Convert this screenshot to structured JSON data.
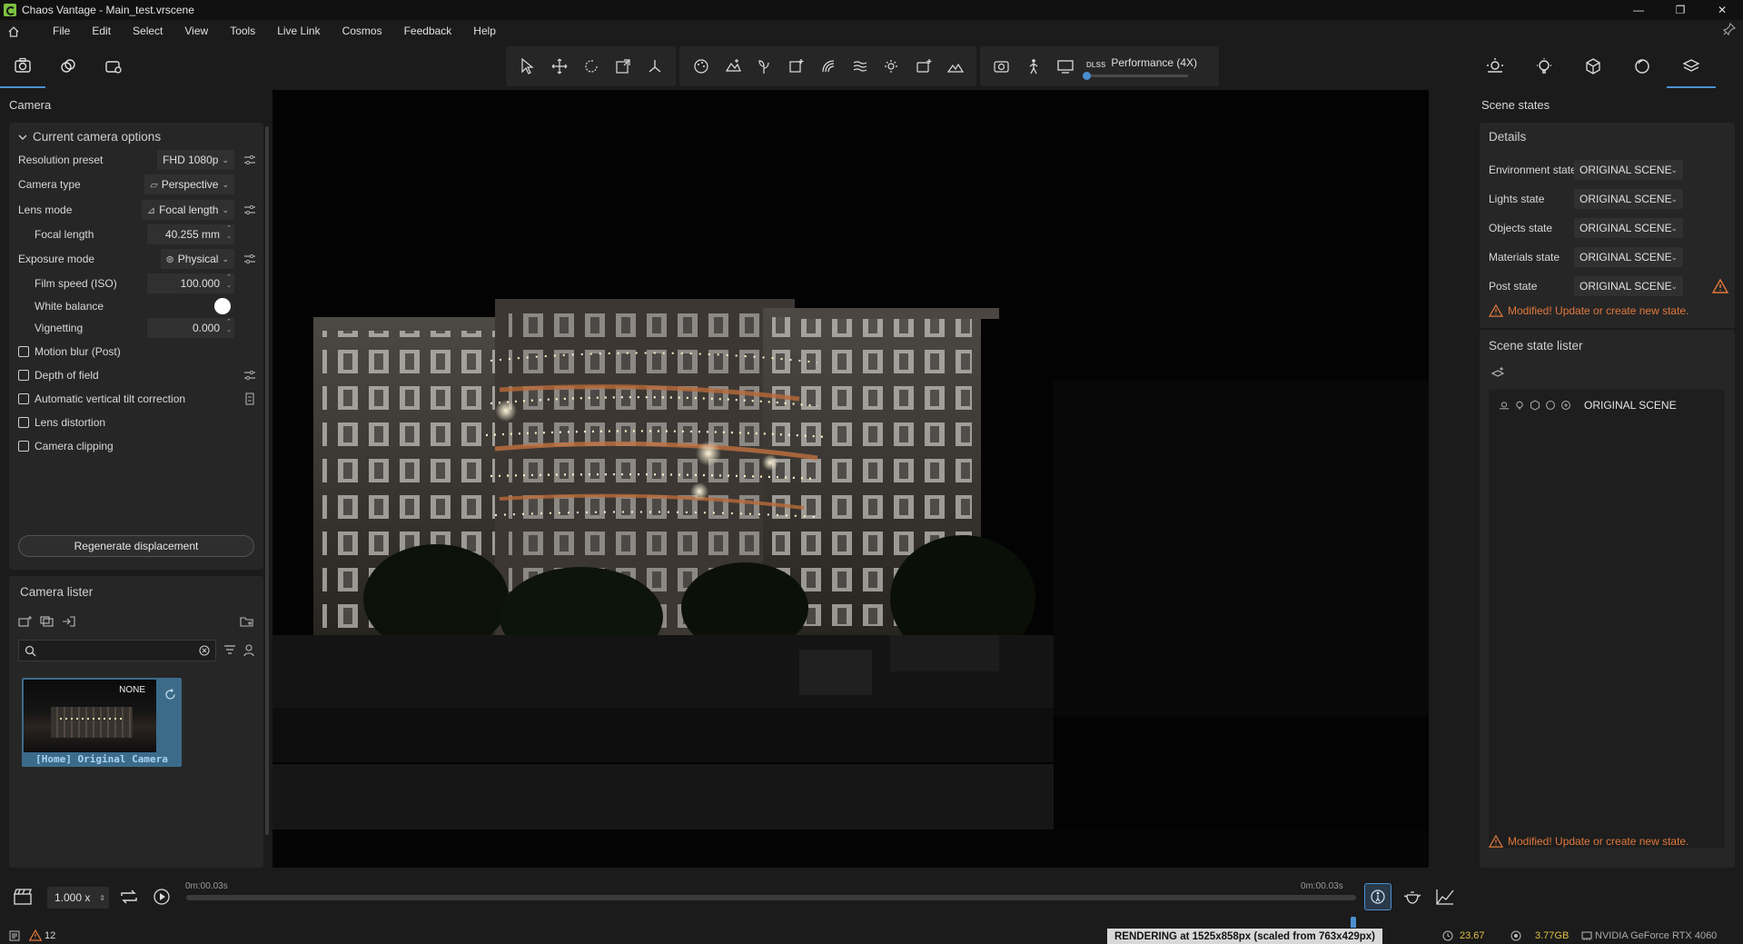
{
  "window": {
    "title": "Chaos Vantage - Main_test.vrscene"
  },
  "menu": [
    "File",
    "Edit",
    "Select",
    "View",
    "Tools",
    "Live Link",
    "Cosmos",
    "Feedback",
    "Help"
  ],
  "toolbar": {
    "performance_label": "Performance (4X)",
    "performance_level": 0.0,
    "dlss_label": "DLSS"
  },
  "left": {
    "panel_title": "Camera",
    "section_title": "Current camera options",
    "resolution_preset": {
      "label": "Resolution preset",
      "value": "FHD 1080p"
    },
    "camera_type": {
      "label": "Camera type",
      "value": "Perspective"
    },
    "lens_mode": {
      "label": "Lens mode",
      "value": "Focal length"
    },
    "focal_length": {
      "label": "Focal length",
      "value": "40.255 mm"
    },
    "exposure_mode": {
      "label": "Exposure mode",
      "value": "Physical"
    },
    "film_speed": {
      "label": "Film speed (ISO)",
      "value": "100.000"
    },
    "white_balance": {
      "label": "White balance",
      "color": "#ffffff"
    },
    "vignetting": {
      "label": "Vignetting",
      "value": "0.000"
    },
    "checkboxes": [
      {
        "label": "Motion blur (Post)",
        "checked": false
      },
      {
        "label": "Depth of field",
        "checked": false
      },
      {
        "label": "Automatic vertical tilt correction",
        "checked": false
      },
      {
        "label": "Lens distortion",
        "checked": false
      },
      {
        "label": "Camera clipping",
        "checked": false
      }
    ],
    "regen_button": "Regenerate displacement",
    "lister_title": "Camera lister",
    "search_placeholder": "",
    "camera_card": {
      "badge": "NONE",
      "name": "[Home] Original Camera"
    }
  },
  "right": {
    "panel_title": "Scene states",
    "details_title": "Details",
    "states": [
      {
        "label": "Environment state",
        "value": "ORIGINAL SCENE"
      },
      {
        "label": "Lights state",
        "value": "ORIGINAL SCENE"
      },
      {
        "label": "Objects state",
        "value": "ORIGINAL SCENE"
      },
      {
        "label": "Materials state",
        "value": "ORIGINAL SCENE"
      },
      {
        "label": "Post state",
        "value": "ORIGINAL SCENE"
      }
    ],
    "warning": "Modified! Update or create new state.",
    "lister_title": "Scene state lister",
    "lister_item": "ORIGINAL SCENE",
    "bottom_warning": "Modified! Update or create new state."
  },
  "timeline": {
    "speed": "1.000 x",
    "start_time": "0m:00.03s",
    "end_time": "0m:00.03s",
    "position": 1.0
  },
  "status": {
    "warning_count": "12",
    "render_message": "RENDERING at 1525x858px (scaled from 763x429px)",
    "fps": "23.67",
    "vram": "3.77GB",
    "gpu": "NVIDIA GeForce RTX 4060"
  },
  "colors": {
    "accent": "#4b8fd1",
    "warning": "#e0783c",
    "status_value": "#e0c040"
  }
}
